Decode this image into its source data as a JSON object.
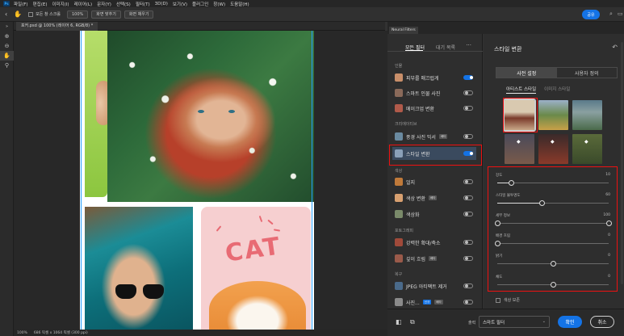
{
  "menubar": {
    "logo": "Ps",
    "items": [
      "파일(F)",
      "편집(E)",
      "이미지(I)",
      "레이어(L)",
      "문자(Y)",
      "선택(S)",
      "필터(T)",
      "3D(D)",
      "보기(V)",
      "플러그인",
      "창(W)",
      "도움말(H)"
    ]
  },
  "options": {
    "all_windows": "모든 창 스크롤",
    "zoom": "100%",
    "fit_screen": "화면 맞추기",
    "fill_screen": "화면 채우기",
    "share": "공유"
  },
  "document": {
    "tab": "포커.psd @ 100% (레이어 6, RGB/8) *",
    "status_zoom": "100%",
    "status_size": "686 픽셀 x 1064 픽셀 (300 ppi)",
    "cat_text": "CAT"
  },
  "neural_filters": {
    "panel_tab": "Neural Filters",
    "tabs": [
      "모든 필터",
      "대기 목록"
    ],
    "more": "···",
    "sections": {
      "portraits": "인물",
      "creative": "크리에이티브",
      "color": "색상",
      "photography": "포토그래피",
      "restoration": "복구"
    },
    "filters": [
      {
        "label": "피부를 매끄럽게",
        "badge": "",
        "on": true,
        "color": "#c98f6a"
      },
      {
        "label": "스마트 인물 사진",
        "badge": "",
        "on": false,
        "color": "#8a6a5a"
      },
      {
        "label": "메이크업 변환",
        "badge": "",
        "on": false,
        "color": "#b05a4a"
      },
      {
        "label": "풍경 사진 믹서",
        "badge": "베타",
        "on": false,
        "color": "#6a8aa0"
      },
      {
        "label": "스타일 변환",
        "badge": "",
        "on": true,
        "color": "#8aa0b8"
      },
      {
        "label": "얼지",
        "badge": "",
        "on": false,
        "color": "#c07a3a"
      },
      {
        "label": "색상 변환",
        "badge": "베타",
        "on": false,
        "color": "#d8a070"
      },
      {
        "label": "색상화",
        "badge": "",
        "on": false,
        "color": "#7a8a6a"
      },
      {
        "label": "강력한 확대/축소",
        "badge": "",
        "on": false,
        "color": "#a04a3a"
      },
      {
        "label": "깊이 흐림",
        "badge": "베타",
        "on": false,
        "color": "#9a5a4a"
      },
      {
        "label": "JPEG 아티팩트 제거",
        "badge": "",
        "on": false,
        "color": "#4a6a8a"
      },
      {
        "label": "사진...",
        "badge": "신규",
        "badge2": "베타",
        "on": false,
        "color": "#8a8a8a"
      }
    ]
  },
  "style_transfer": {
    "title": "스타일 변환",
    "seg": [
      "사전 설정",
      "사용자 정의"
    ],
    "subtabs": [
      "아티스트 스타일",
      "이미지 스타일"
    ],
    "thumbs": [
      {
        "color": "#a05a3a"
      },
      {
        "color": "#6a8a4a"
      },
      {
        "color": "#5a7a8a"
      },
      {
        "color": "#6a5a4a"
      },
      {
        "color": "#8a3a2a"
      },
      {
        "color": "#5a6a3a"
      }
    ],
    "sliders": [
      {
        "label": "강도",
        "value": "10",
        "pct": 12
      },
      {
        "label": "스타일 불투명도",
        "value": "60",
        "pct": 40
      },
      {
        "label": "세부 정보",
        "value": "100",
        "pct": 0
      },
      {
        "label": "배경 흐림",
        "value": "0",
        "pct": 0
      },
      {
        "label": "밝기",
        "value": "0",
        "pct": 50
      },
      {
        "label": "채도",
        "value": "0",
        "pct": 50
      }
    ],
    "preserve_color": "색상 보존"
  },
  "footer": {
    "output_label": "출력",
    "output_value": "스마트 필터",
    "ok": "확인",
    "cancel": "취소"
  },
  "colors": {
    "accent": "#1473e6",
    "highlight_box": "#e11111"
  }
}
